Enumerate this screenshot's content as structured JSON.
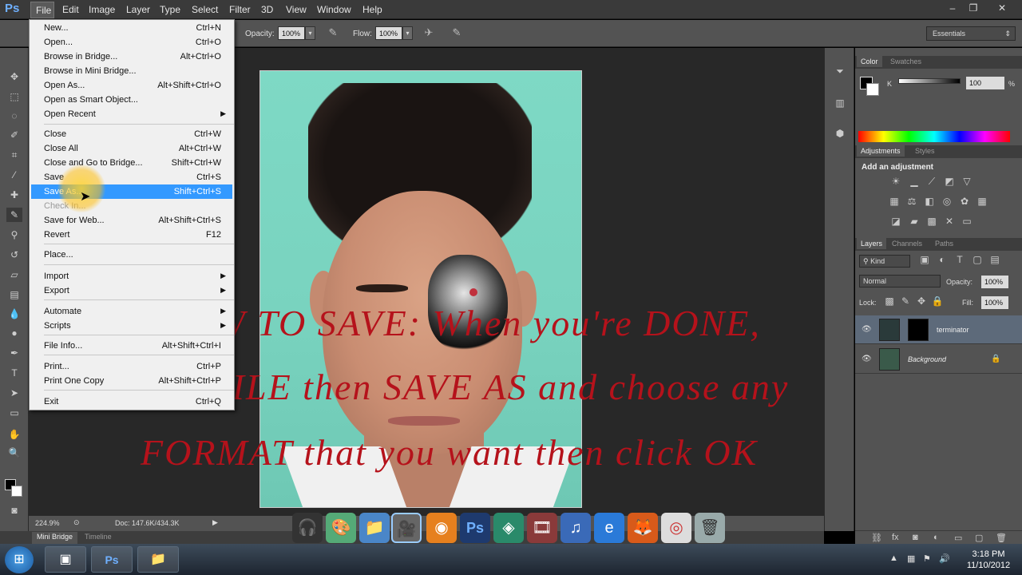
{
  "app": {
    "logo": "Ps"
  },
  "menubar": {
    "items": [
      "File",
      "Edit",
      "Image",
      "Layer",
      "Type",
      "Select",
      "Filter",
      "3D",
      "View",
      "Window",
      "Help"
    ]
  },
  "window_controls": {
    "minimize": "–",
    "restore": "❐",
    "close": "✕"
  },
  "options_bar": {
    "opacity_label": "Opacity:",
    "opacity_value": "100%",
    "flow_label": "Flow:",
    "flow_value": "100%",
    "workspace": "Essentials"
  },
  "file_menu": {
    "items": [
      {
        "label": "New...",
        "shortcut": "Ctrl+N"
      },
      {
        "label": "Open...",
        "shortcut": "Ctrl+O"
      },
      {
        "label": "Browse in Bridge...",
        "shortcut": "Alt+Ctrl+O"
      },
      {
        "label": "Browse in Mini Bridge...",
        "shortcut": ""
      },
      {
        "label": "Open As...",
        "shortcut": "Alt+Shift+Ctrl+O"
      },
      {
        "label": "Open as Smart Object...",
        "shortcut": ""
      },
      {
        "label": "Open Recent",
        "shortcut": ""
      },
      {
        "label": "Close",
        "shortcut": "Ctrl+W"
      },
      {
        "label": "Close All",
        "shortcut": "Alt+Ctrl+W"
      },
      {
        "label": "Close and Go to Bridge...",
        "shortcut": "Shift+Ctrl+W"
      },
      {
        "label": "Save",
        "shortcut": "Ctrl+S"
      },
      {
        "label": "Save As...",
        "shortcut": "Shift+Ctrl+S"
      },
      {
        "label": "Check In...",
        "shortcut": ""
      },
      {
        "label": "Save for Web...",
        "shortcut": "Alt+Shift+Ctrl+S"
      },
      {
        "label": "Revert",
        "shortcut": "F12"
      },
      {
        "label": "Place...",
        "shortcut": ""
      },
      {
        "label": "Import",
        "shortcut": ""
      },
      {
        "label": "Export",
        "shortcut": ""
      },
      {
        "label": "Automate",
        "shortcut": ""
      },
      {
        "label": "Scripts",
        "shortcut": ""
      },
      {
        "label": "File Info...",
        "shortcut": "Alt+Shift+Ctrl+I"
      },
      {
        "label": "Print...",
        "shortcut": "Ctrl+P"
      },
      {
        "label": "Print One Copy",
        "shortcut": "Alt+Shift+Ctrl+P"
      },
      {
        "label": "Exit",
        "shortcut": "Ctrl+Q"
      }
    ],
    "submenu_arrow": "▶"
  },
  "overlay_text": {
    "line1": "HOW TO SAVE: When you're DONE,",
    "line2": "Click FILE then SAVE AS and choose any",
    "line3": "FORMAT that you want then click OK"
  },
  "status_bar": {
    "zoom": "224.9%",
    "doc": "Doc: 147.6K/434.3K",
    "arrow": "▶"
  },
  "bottom_tabs": {
    "mini_bridge": "Mini Bridge",
    "timeline": "Timeline"
  },
  "color_panel": {
    "tab_color": "Color",
    "tab_swatches": "Swatches",
    "channel": "K",
    "value": "100",
    "unit": "%"
  },
  "adjustments_panel": {
    "tab_adjustments": "Adjustments",
    "tab_styles": "Styles",
    "title": "Add an adjustment"
  },
  "layers_panel": {
    "tab_layers": "Layers",
    "tab_channels": "Channels",
    "tab_paths": "Paths",
    "filter_kind": "Kind",
    "blend_mode": "Normal",
    "opacity_label": "Opacity:",
    "opacity_value": "100%",
    "lock_label": "Lock:",
    "fill_label": "Fill:",
    "fill_value": "100%",
    "layers": [
      {
        "name": "terminator"
      },
      {
        "name": "Background"
      }
    ]
  },
  "taskbar": {
    "time": "3:18 PM",
    "date": "11/10/2012"
  },
  "colors": {
    "accent": "#3399ff",
    "overlay_red": "#b5121b",
    "panel": "#535353",
    "canvas_bg": "#282828"
  }
}
